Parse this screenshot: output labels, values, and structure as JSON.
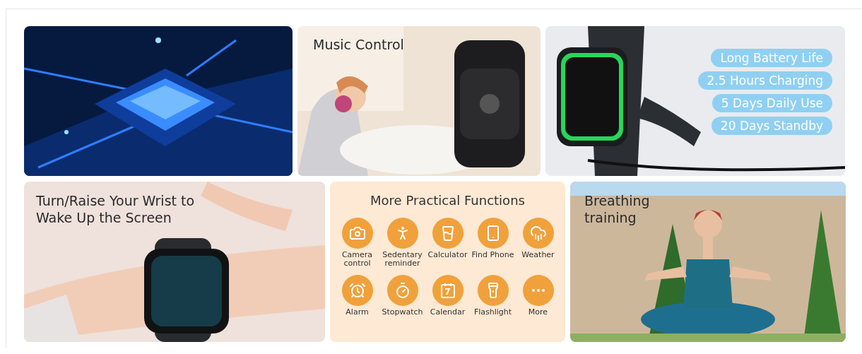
{
  "tiles": [
    {
      "kind": "picture"
    },
    {
      "kind": "picture",
      "caption": "Music Control"
    },
    {
      "kind": "picture",
      "badges": [
        "Long Battery Life",
        "2.5 Hours Charging",
        "5 Days Daily Use",
        "20 Days Standby"
      ]
    },
    {
      "kind": "picture",
      "caption": "Turn/Raise Your Wrist to Wake Up the Screen"
    },
    {
      "kind": "functions",
      "title": "More Practical Functions",
      "functions": [
        {
          "label": "Camera control"
        },
        {
          "label": "Sedentary reminder"
        },
        {
          "label": "Calculator"
        },
        {
          "label": "Find Phone"
        },
        {
          "label": "Weather"
        },
        {
          "label": "Alarm"
        },
        {
          "label": "Stopwatch"
        },
        {
          "label": "Calendar",
          "glyph": "7"
        },
        {
          "label": "Flashlight"
        },
        {
          "label": "More"
        }
      ]
    },
    {
      "kind": "picture",
      "caption": "Breathing training"
    }
  ]
}
